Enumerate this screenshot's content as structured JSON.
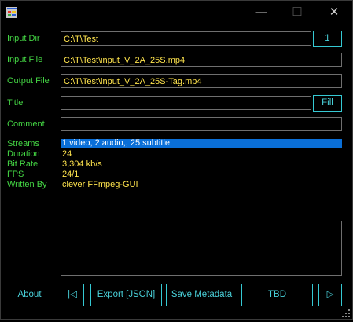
{
  "window": {
    "minimize_glyph": "—",
    "maximize_glyph": "☐",
    "close_glyph": "✕"
  },
  "fields": {
    "input_dir": {
      "label": "Input Dir",
      "value": "C:\\T\\Test",
      "button": "1"
    },
    "input_file": {
      "label": "Input File",
      "value": "C:\\T\\Test\\input_V_2A_25S.mp4"
    },
    "output_file": {
      "label": "Output File",
      "value": "C:\\T\\Test\\input_V_2A_25S-Tag.mp4"
    },
    "title": {
      "label": "Title",
      "value": "",
      "button": "Fill"
    },
    "comment": {
      "label": "Comment",
      "value": ""
    }
  },
  "info": {
    "streams": {
      "label": "Streams",
      "value": "1 video, 2 audio,, 25 subtitle"
    },
    "duration": {
      "label": "Duration",
      "value": "24"
    },
    "bit_rate": {
      "label": "Bit Rate",
      "value": "3,304 kb/s"
    },
    "fps": {
      "label": "FPS",
      "value": "24/1"
    },
    "written_by": {
      "label": "Written By",
      "value": "clever FFmpeg-GUI"
    }
  },
  "buttons": {
    "about": "About",
    "prev": "|◁",
    "export_json": "Export [JSON]",
    "save_metadata": "Save Metadata",
    "tbd": "TBD",
    "next": "▷"
  },
  "colors": {
    "label_green": "#44d644",
    "value_yellow": "#ffe44d",
    "button_cyan": "#35c9d3",
    "selection_blue": "#0a6fd8",
    "background": "#000000"
  }
}
